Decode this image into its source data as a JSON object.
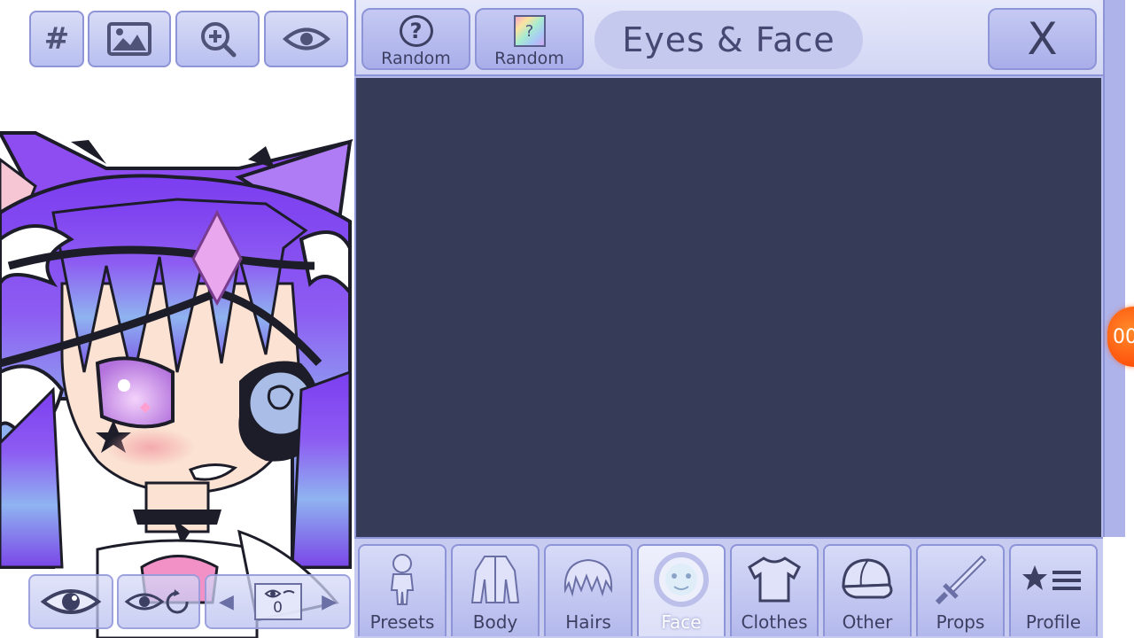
{
  "preview": {
    "top_tools": [
      {
        "name": "hash",
        "glyph": "#"
      },
      {
        "name": "background",
        "icon": "image-icon"
      },
      {
        "name": "zoom",
        "icon": "zoom-in-icon"
      },
      {
        "name": "visibility",
        "icon": "eye-icon"
      }
    ],
    "bottom_tools": {
      "eye_icon": "eye-icon",
      "eye_reset_icon": "eye-reset-icon",
      "layer_value": "0"
    }
  },
  "header": {
    "random_buttons": [
      {
        "label": "Random",
        "icon": "question-circle-icon"
      },
      {
        "label": "Random",
        "icon": "rainbow-question-icon"
      }
    ],
    "title": "Eyes & Face",
    "close_label": "X"
  },
  "tabs": [
    {
      "label": "Presets",
      "icon": "presets-icon",
      "active": false
    },
    {
      "label": "Body",
      "icon": "body-icon",
      "active": false
    },
    {
      "label": "Hairs",
      "icon": "hair-icon",
      "active": false
    },
    {
      "label": "Face",
      "icon": "face-icon",
      "active": true
    },
    {
      "label": "Clothes",
      "icon": "shirt-icon",
      "active": false
    },
    {
      "label": "Other",
      "icon": "cap-icon",
      "active": false
    },
    {
      "label": "Props",
      "icon": "sword-icon",
      "active": false
    },
    {
      "label": "Profile",
      "icon": "star-list-icon",
      "active": false
    }
  ],
  "overlay": {
    "record_text": "00"
  },
  "colors": {
    "panel_bg": "#363b57",
    "button_bg": "#b9bff0",
    "accent_border": "#8e94d8",
    "text": "#3d4062",
    "hair_purple": "#8a4de6",
    "eye_pink": "#d9a6f0"
  }
}
